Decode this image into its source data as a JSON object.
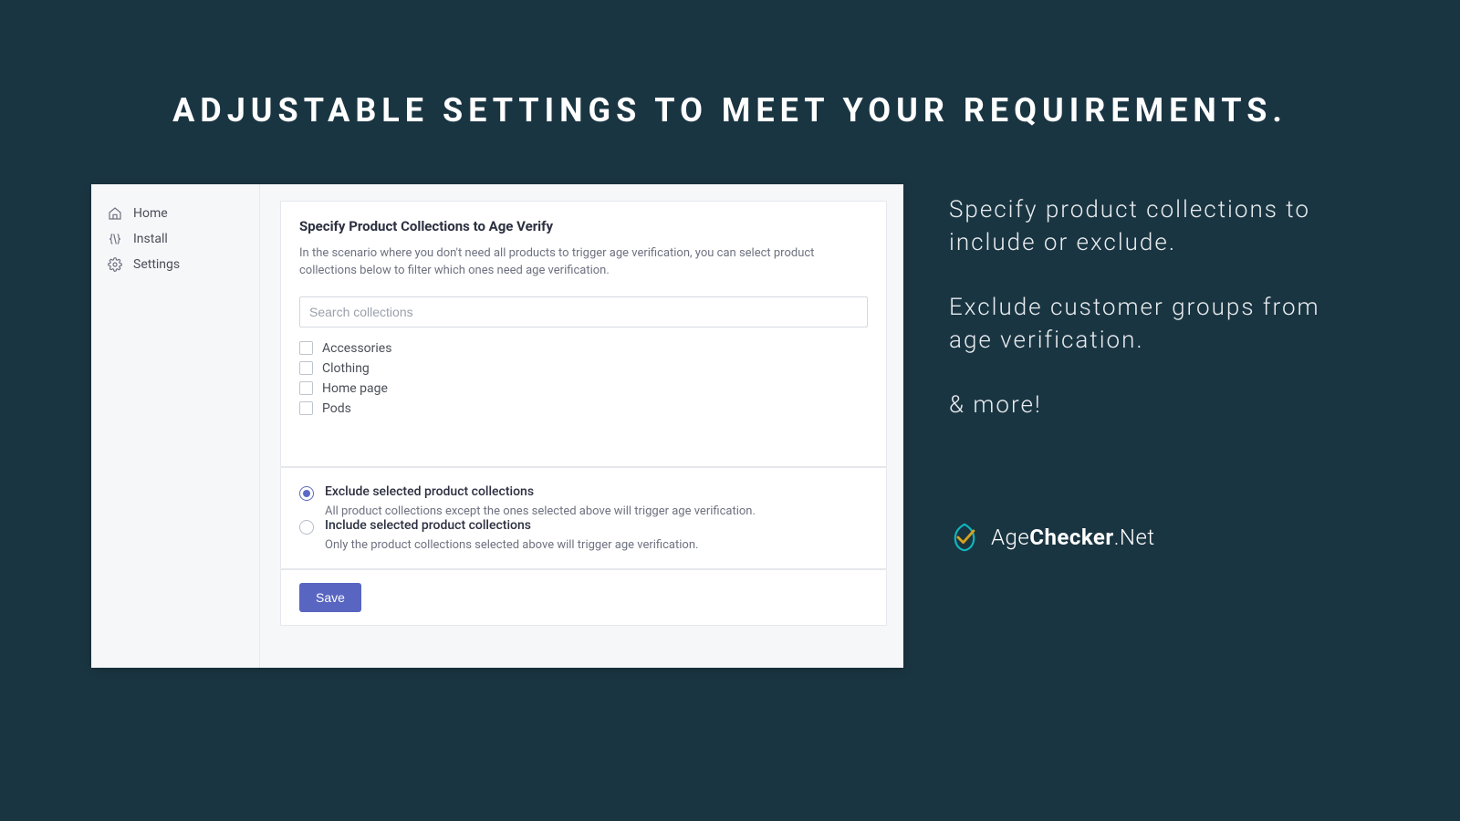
{
  "hero": {
    "title": "ADJUSTABLE SETTINGS TO MEET YOUR REQUIREMENTS."
  },
  "sidebar": {
    "items": [
      {
        "label": "Home"
      },
      {
        "label": "Install"
      },
      {
        "label": "Settings"
      }
    ]
  },
  "panel": {
    "heading": "Specify Product Collections to Age Verify",
    "description": "In the scenario where you don't need all products to trigger age verification, you can select product collections below to filter which ones need age verification.",
    "search_placeholder": "Search collections",
    "collections": [
      {
        "label": "Accessories",
        "checked": false
      },
      {
        "label": "Clothing",
        "checked": false
      },
      {
        "label": "Home page",
        "checked": false
      },
      {
        "label": "Pods",
        "checked": false
      }
    ],
    "radio_options": [
      {
        "label": "Exclude selected product collections",
        "sub": "All product collections except the ones selected above will trigger age verification.",
        "selected": true
      },
      {
        "label": "Include selected product collections",
        "sub": "Only the product collections selected above will trigger age verification.",
        "selected": false
      }
    ],
    "save_label": "Save"
  },
  "marketing": {
    "line1": "Specify product collections to include or exclude.",
    "line2": "Exclude customer groups from age verification.",
    "line3": "& more!"
  },
  "brand": {
    "part1": "Age",
    "part2": "Checker",
    "part3": ".Net"
  }
}
